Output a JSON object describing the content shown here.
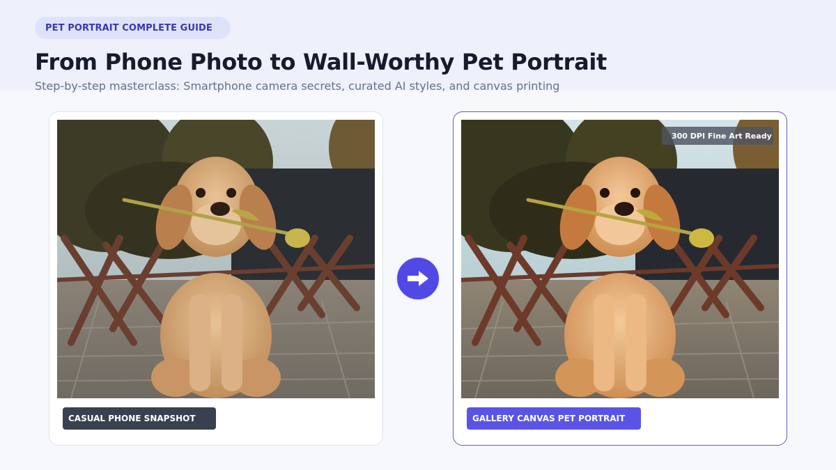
{
  "header": {
    "badge": "PET PORTRAIT COMPLETE GUIDE",
    "title": "From Phone Photo to Wall-Worthy Pet Portrait",
    "subtitle": "Step-by-step masterclass: Smartphone camera secrets, curated AI styles, and canvas printing"
  },
  "before_card": {
    "image_subject": "golden retriever puppy holding a tulip in its mouth",
    "caption": "CASUAL PHONE SNAPSHOT"
  },
  "after_card": {
    "image_subject": "golden retriever puppy holding a tulip in its mouth, enhanced",
    "caption": "GALLERY CANVAS PET PORTRAIT",
    "badge": "300 DPI Fine Art Ready"
  },
  "transition": {
    "icon": "arrow-right-icon"
  },
  "colors": {
    "accent": "#5149e6",
    "title": "#161c2d",
    "subtitle": "#66718a",
    "dark_caption": "#394150"
  }
}
